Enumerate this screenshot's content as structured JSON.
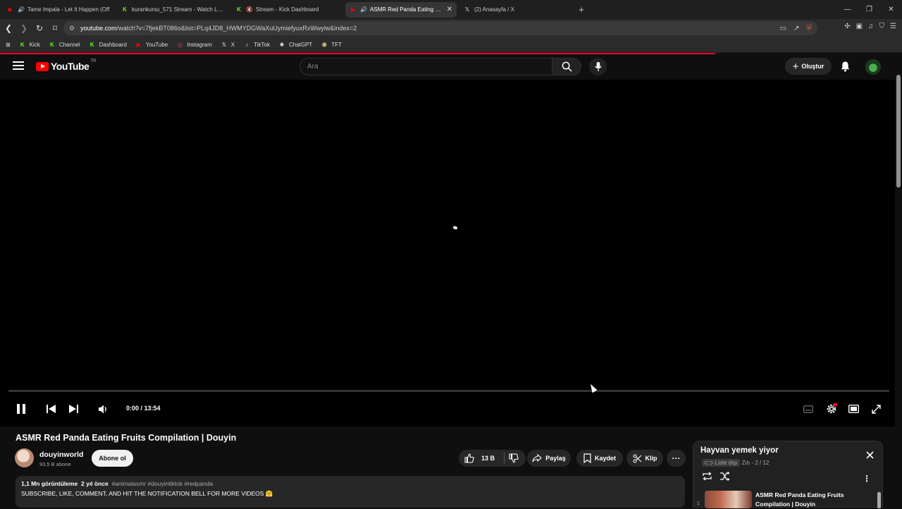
{
  "browser": {
    "tabs": [
      {
        "title": "Tame Impala - Let It Happen (Off",
        "icon": "youtube-icon",
        "audio": true,
        "active": false
      },
      {
        "title": "kurankursu_571 Stream - Watch Live",
        "icon": "kick-icon",
        "audio": false,
        "active": false
      },
      {
        "title": "Stream - Kick Dashboard",
        "icon": "kick-icon",
        "audio": true,
        "active": false
      },
      {
        "title": "ASMR Red Panda Eating Fruits",
        "icon": "youtube-icon",
        "audio": true,
        "active": true
      },
      {
        "title": "(2) Anasayfa / X",
        "icon": "x-icon",
        "audio": false,
        "active": false
      }
    ],
    "url_host": "youtube.com",
    "url_path": "/watch?v=7fjekBT086o&list=PLq4JD8_HWMYDGWaXuUymiefyuxRxWwylw&index=2",
    "bookmarks": [
      {
        "label": "Kick",
        "icon": "kick-icon"
      },
      {
        "label": "Channel",
        "icon": "kick-icon"
      },
      {
        "label": "Dashboard",
        "icon": "kick-icon"
      },
      {
        "label": "YouTube",
        "icon": "youtube-icon"
      },
      {
        "label": "Instagram",
        "icon": "instagram-icon"
      },
      {
        "label": "X",
        "icon": "x-icon"
      },
      {
        "label": "TikTok",
        "icon": "tiktok-icon"
      },
      {
        "label": "ChatGPT",
        "icon": "chatgpt-icon"
      },
      {
        "label": "TFT",
        "icon": "tft-icon"
      }
    ]
  },
  "header": {
    "logo_text": "YouTube",
    "region": "TR",
    "search_placeholder": "Ara",
    "create_label": "Oluştur"
  },
  "player": {
    "time": "0:00 / 13:54",
    "progress": 0
  },
  "video": {
    "title": "ASMR Red Panda Eating Fruits Compilation | Douyin",
    "channel": "douyinworld",
    "subscribers": "93,5 B abone",
    "subscribe_label": "Abone ol",
    "likes": "13 B",
    "share_label": "Paylaş",
    "save_label": "Kaydet",
    "clip_label": "Klip",
    "views": "1,1 Mn görüntüleme",
    "age": "2 yıl önce",
    "tags": "#animalasmr #douyintiktok #redpanda",
    "description": "SUBSCRIBE, LIKE, COMMENT, AND HIT THE NOTIFICATION BELL FOR MORE VIDEOS 🤗"
  },
  "playlist": {
    "title": "Hayvan yemek yiyor",
    "visibility": "Liste dışı",
    "owner": "Zıtı",
    "position": "2 / 12",
    "current_item_index": "1",
    "current_item_title": "ASMR Red Panda Eating Fruits Compilation | Douyin"
  },
  "colors": {
    "accent": "#ff0033",
    "kick": "#53fc18",
    "youtube": "#ff0000"
  }
}
